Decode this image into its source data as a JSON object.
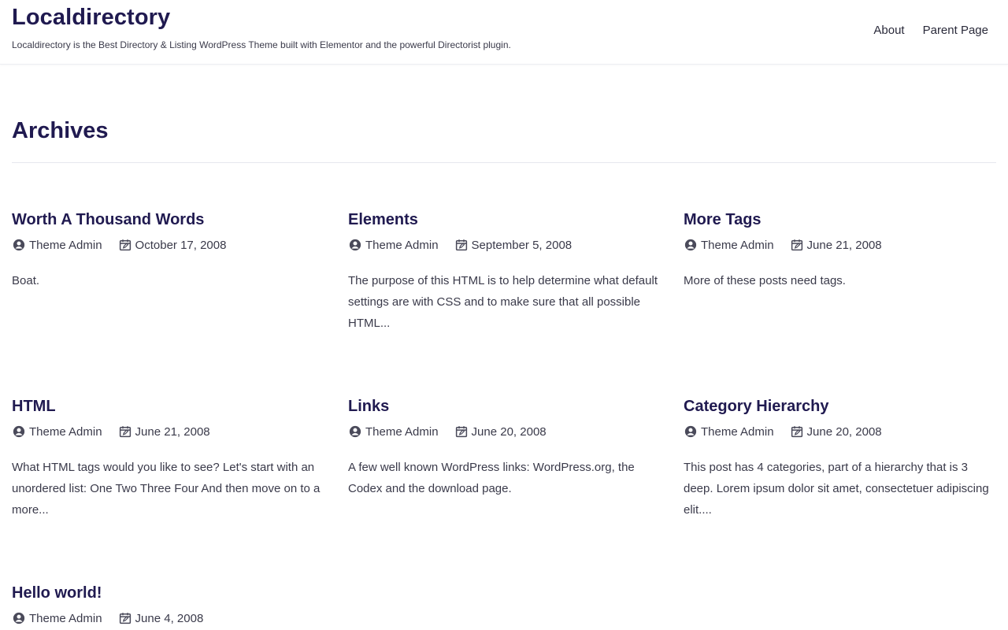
{
  "site": {
    "title": "Localdirectory",
    "tagline": "Localdirectory is the Best Directory & Listing WordPress Theme built with Elementor and the powerful Directorist plugin."
  },
  "nav": {
    "items": [
      "About",
      "Parent Page"
    ]
  },
  "archive": {
    "title": "Archives"
  },
  "posts": [
    {
      "title": "Worth A Thousand Words",
      "author": "Theme Admin",
      "date": "October 17, 2008",
      "excerpt": "Boat."
    },
    {
      "title": "Elements",
      "author": "Theme Admin",
      "date": "September 5, 2008",
      "excerpt": "The purpose of this HTML is to help determine what default settings are with CSS and to make sure that all possible HTML..."
    },
    {
      "title": "More Tags",
      "author": "Theme Admin",
      "date": "June 21, 2008",
      "excerpt": "More of these posts need tags."
    },
    {
      "title": "HTML",
      "author": "Theme Admin",
      "date": "June 21, 2008",
      "excerpt": "What HTML tags would you like to see? Let's start with an unordered list: One Two Three Four And then move on to a more..."
    },
    {
      "title": "Links",
      "author": "Theme Admin",
      "date": "June 20, 2008",
      "excerpt": "A few well known WordPress links: WordPress.org, the Codex and the download page."
    },
    {
      "title": "Category Hierarchy",
      "author": "Theme Admin",
      "date": "June 20, 2008",
      "excerpt": "This post has 4 categories, part of a hierarchy that is 3 deep. Lorem ipsum dolor sit amet, consectetuer adipiscing elit...."
    },
    {
      "title": "Hello world!",
      "author": "Theme Admin",
      "date": "June 4, 2008",
      "excerpt": ""
    }
  ],
  "icons": {
    "author": "user-circle-icon",
    "date": "calendar-edit-icon"
  },
  "colors": {
    "heading": "#201a50",
    "text": "#3a3a4a",
    "divider": "#e6e8ee"
  }
}
